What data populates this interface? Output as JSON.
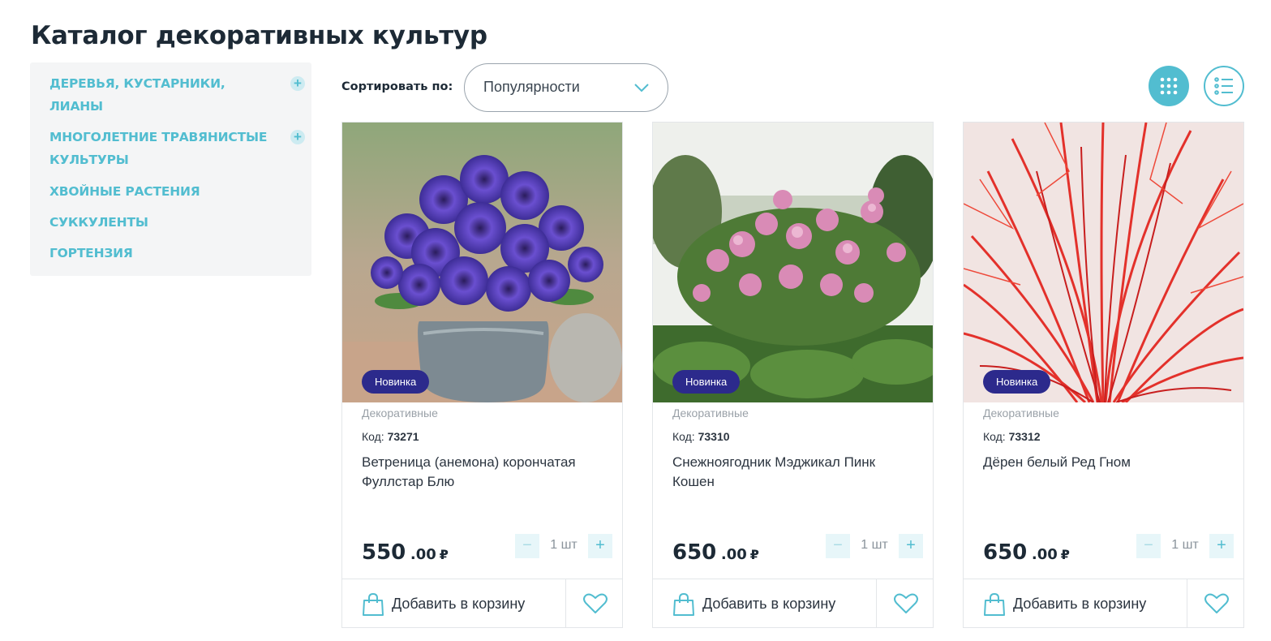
{
  "page": {
    "title": "Каталог декоративных культур"
  },
  "sidebar": {
    "items": [
      {
        "label": "Деревья, кустарники, лианы",
        "expandable": true
      },
      {
        "label": "Многолетние травянистые культуры",
        "expandable": true
      },
      {
        "label": "Хвойные растения",
        "expandable": false
      },
      {
        "label": "Суккуленты",
        "expandable": false
      },
      {
        "label": "Гортензия",
        "expandable": false
      }
    ],
    "plus_symbol": "+"
  },
  "sort": {
    "label": "Сортировать по:",
    "selected": "Популярности",
    "chevron_icon": "chevron-down-icon"
  },
  "view_toggle": {
    "grid_icon": "grid-view-icon",
    "list_icon": "list-view-icon",
    "active": "grid"
  },
  "colors": {
    "accent": "#52bdd0",
    "badge": "#2c2a8c",
    "text": "#1d2a36",
    "muted": "#9aa1a8"
  },
  "products": [
    {
      "badge": "Новинка",
      "category": "Декоративные",
      "code_label": "Код:",
      "code": "73271",
      "name": "Ветреница (анемона) корончатая Фуллстар Блю",
      "price_int": "550",
      "price_dec": ".00",
      "currency": "₽",
      "qty": "1 шт",
      "qty_minus": "−",
      "qty_plus": "+",
      "add_label": "Добавить в корзину"
    },
    {
      "badge": "Новинка",
      "category": "Декоративные",
      "code_label": "Код:",
      "code": "73310",
      "name": "Снежноягодник Мэджикал Пинк Кошен",
      "price_int": "650",
      "price_dec": ".00",
      "currency": "₽",
      "qty": "1 шт",
      "qty_minus": "−",
      "qty_plus": "+",
      "add_label": "Добавить в корзину"
    },
    {
      "badge": "Новинка",
      "category": "Декоративные",
      "code_label": "Код:",
      "code": "73312",
      "name": "Дёрен белый Ред Гном",
      "price_int": "650",
      "price_dec": ".00",
      "currency": "₽",
      "qty": "1 шт",
      "qty_minus": "−",
      "qty_plus": "+",
      "add_label": "Добавить в корзину"
    }
  ]
}
